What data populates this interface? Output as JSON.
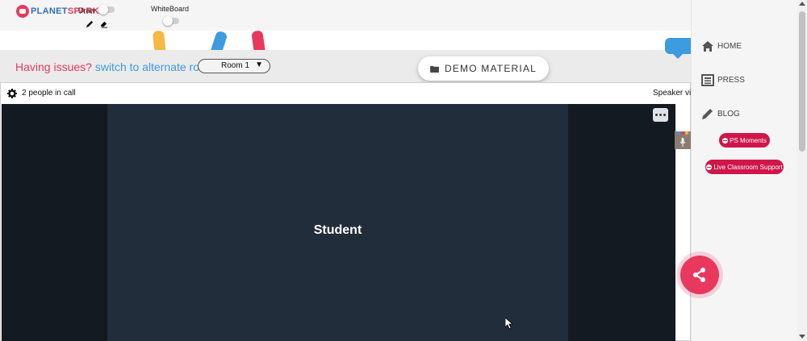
{
  "app": {
    "logo_part1": "PLANET",
    "logo_part2": "SPARK",
    "draw_label": "Draw",
    "whiteboard_label": "WhiteBoard"
  },
  "notice": {
    "issue_text": "Having issues?",
    "switch_link": "switch to alternate room",
    "room_selected": "Room 1"
  },
  "demo_material_label": "DEMO MATERIAL",
  "call": {
    "people_count_text": "2 people in call",
    "view_mode_text": "Speaker vi",
    "participant_name": "Student"
  },
  "sidebar": {
    "items": [
      {
        "label": "HOME",
        "icon": "home-icon"
      },
      {
        "label": "PRESS",
        "icon": "newspaper-icon"
      },
      {
        "label": "BLOG",
        "icon": "pencil-icon"
      }
    ],
    "ps_moments_label": "PS Moments",
    "live_support_label": "Live Classroom Support"
  },
  "colors": {
    "brand_pink": "#e8385e",
    "brand_blue": "#3d9be0",
    "pill_red": "#d0154a",
    "tile_bg": "#212d3b",
    "video_bg": "#131a22"
  }
}
